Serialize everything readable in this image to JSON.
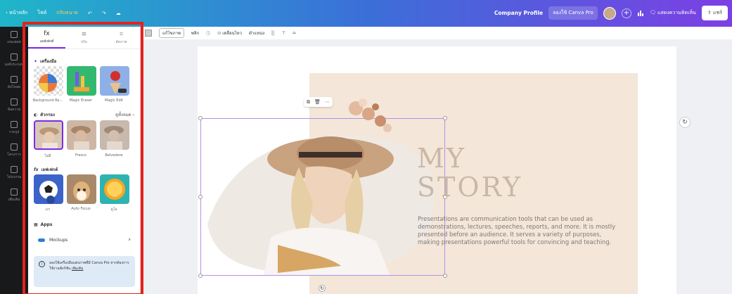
{
  "topbar": {
    "items_left": [
      "‹ หน้าหลัก",
      "ไฟล์",
      "ปรับขนาด",
      "↶",
      "↷",
      "☁"
    ],
    "doc_title": "Company Profile",
    "pro_button": "ลองใช้ Canva Pro",
    "analytics_icon": "bar-chart-icon",
    "comment_label": "แสดงความคิดเห็น",
    "share_label": "แชร์"
  },
  "rail": {
    "items": [
      "เทมเพลต",
      "องค์ประกอบ",
      "อัปโหลด",
      "ข้อความ",
      "วาดรูป",
      "โครงการ",
      "โปรแกรม",
      "เพิ่มเติม"
    ]
  },
  "panel": {
    "tabs": [
      {
        "label": "เอฟเฟกต์",
        "icon": "fx"
      },
      {
        "label": "ปรับ",
        "icon": "≡"
      },
      {
        "label": "ตัดภาพ",
        "icon": "⌗"
      }
    ],
    "tools_section": "เครื่องมือ",
    "tools": [
      {
        "label": "Background Re..."
      },
      {
        "label": "Magic Eraser"
      },
      {
        "label": "Magic Edit"
      }
    ],
    "filters_section": "ตัวกรอง",
    "filters_more": "ดูทั้งหมด ›",
    "filters": [
      {
        "label": "ไม่มี"
      },
      {
        "label": "Fresco"
      },
      {
        "label": "Belvedere"
      }
    ],
    "effects_section": "เอฟเฟกต์",
    "effects": [
      {
        "label": "เงา"
      },
      {
        "label": "Auto Focus"
      },
      {
        "label": "ดูโอ"
      }
    ],
    "apps_section": "Apps",
    "apps_item": "Mockups",
    "notice_text": "ลองใช้เครื่องมือแต่งภาพที่มี Canva Pro หากต้องการใช้งานฟังก์ชัน",
    "notice_link": "เพิ่มเติม"
  },
  "edit_toolbar": {
    "items": [
      "แก้ไขภาพ",
      "พลิก",
      "ⓘ",
      "⬭ เคลื่อนไหว",
      "ตำแหน่ง",
      "░",
      "⊤",
      "⌓"
    ]
  },
  "canvas": {
    "heading_line1": "MY",
    "heading_line2": "STORY",
    "body": "Presentations are communication tools that can be used as demonstrations, lectures, speeches, reports, and more. It is mostly presented before an audience. It serves a variety of purposes, making presentations powerful tools for convincing and teaching.",
    "float_tools": [
      "⧉",
      "🗑",
      "⋯"
    ]
  },
  "colors": {
    "accent": "#7d2ae8",
    "annotation_red": "#e4221c",
    "beige": "#f4e6d8",
    "heading": "#c9b8a6"
  }
}
